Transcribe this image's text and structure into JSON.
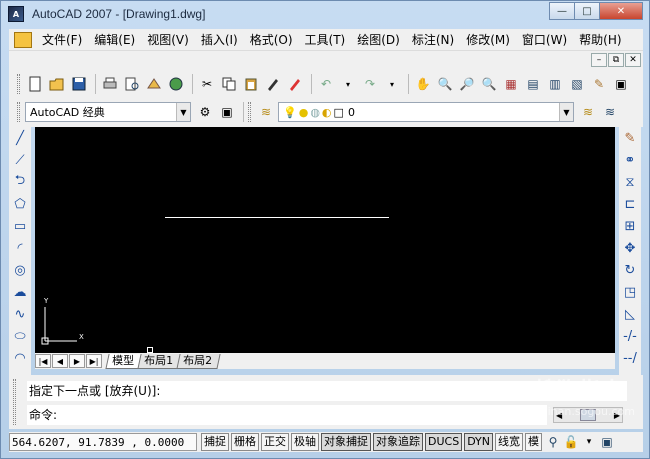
{
  "window": {
    "title": "AutoCAD 2007 - [Drawing1.dwg]",
    "app_icon_text": "A"
  },
  "window_controls": {
    "minimize": "—",
    "maximize": "□",
    "close": "✕"
  },
  "menu": {
    "items": [
      "文件(F)",
      "编辑(E)",
      "视图(V)",
      "插入(I)",
      "格式(O)",
      "工具(T)",
      "绘图(D)",
      "标注(N)",
      "修改(M)",
      "窗口(W)",
      "帮助(H)"
    ]
  },
  "mdi_controls": {
    "minimize": "–",
    "restore": "⧉",
    "close": "✕"
  },
  "workspace_combo": {
    "value": "AutoCAD 经典"
  },
  "layer_combo": {
    "value": "0"
  },
  "layout_tabs": {
    "tabs": [
      "模型",
      "布局1",
      "布局2"
    ],
    "active": "模型"
  },
  "ucs": {
    "y_label": "Y",
    "x_label": "X"
  },
  "command": {
    "history": "指定下一点或 [放弃(U)]:",
    "prompt": "命令:"
  },
  "status": {
    "coordinates": "564.6207,  91.7839 , 0.0000",
    "toggles": [
      {
        "label": "捕捉",
        "on": false
      },
      {
        "label": "栅格",
        "on": false
      },
      {
        "label": "正交",
        "on": false
      },
      {
        "label": "极轴",
        "on": false
      },
      {
        "label": "对象捕捉",
        "on": true
      },
      {
        "label": "对象追踪",
        "on": true
      },
      {
        "label": "DUCS",
        "on": true
      },
      {
        "label": "DYN",
        "on": true
      },
      {
        "label": "线宽",
        "on": false
      },
      {
        "label": "模",
        "on": false
      }
    ]
  },
  "watermark": {
    "main": "搜狗指南",
    "sub": "zhinan.sogou.com"
  }
}
